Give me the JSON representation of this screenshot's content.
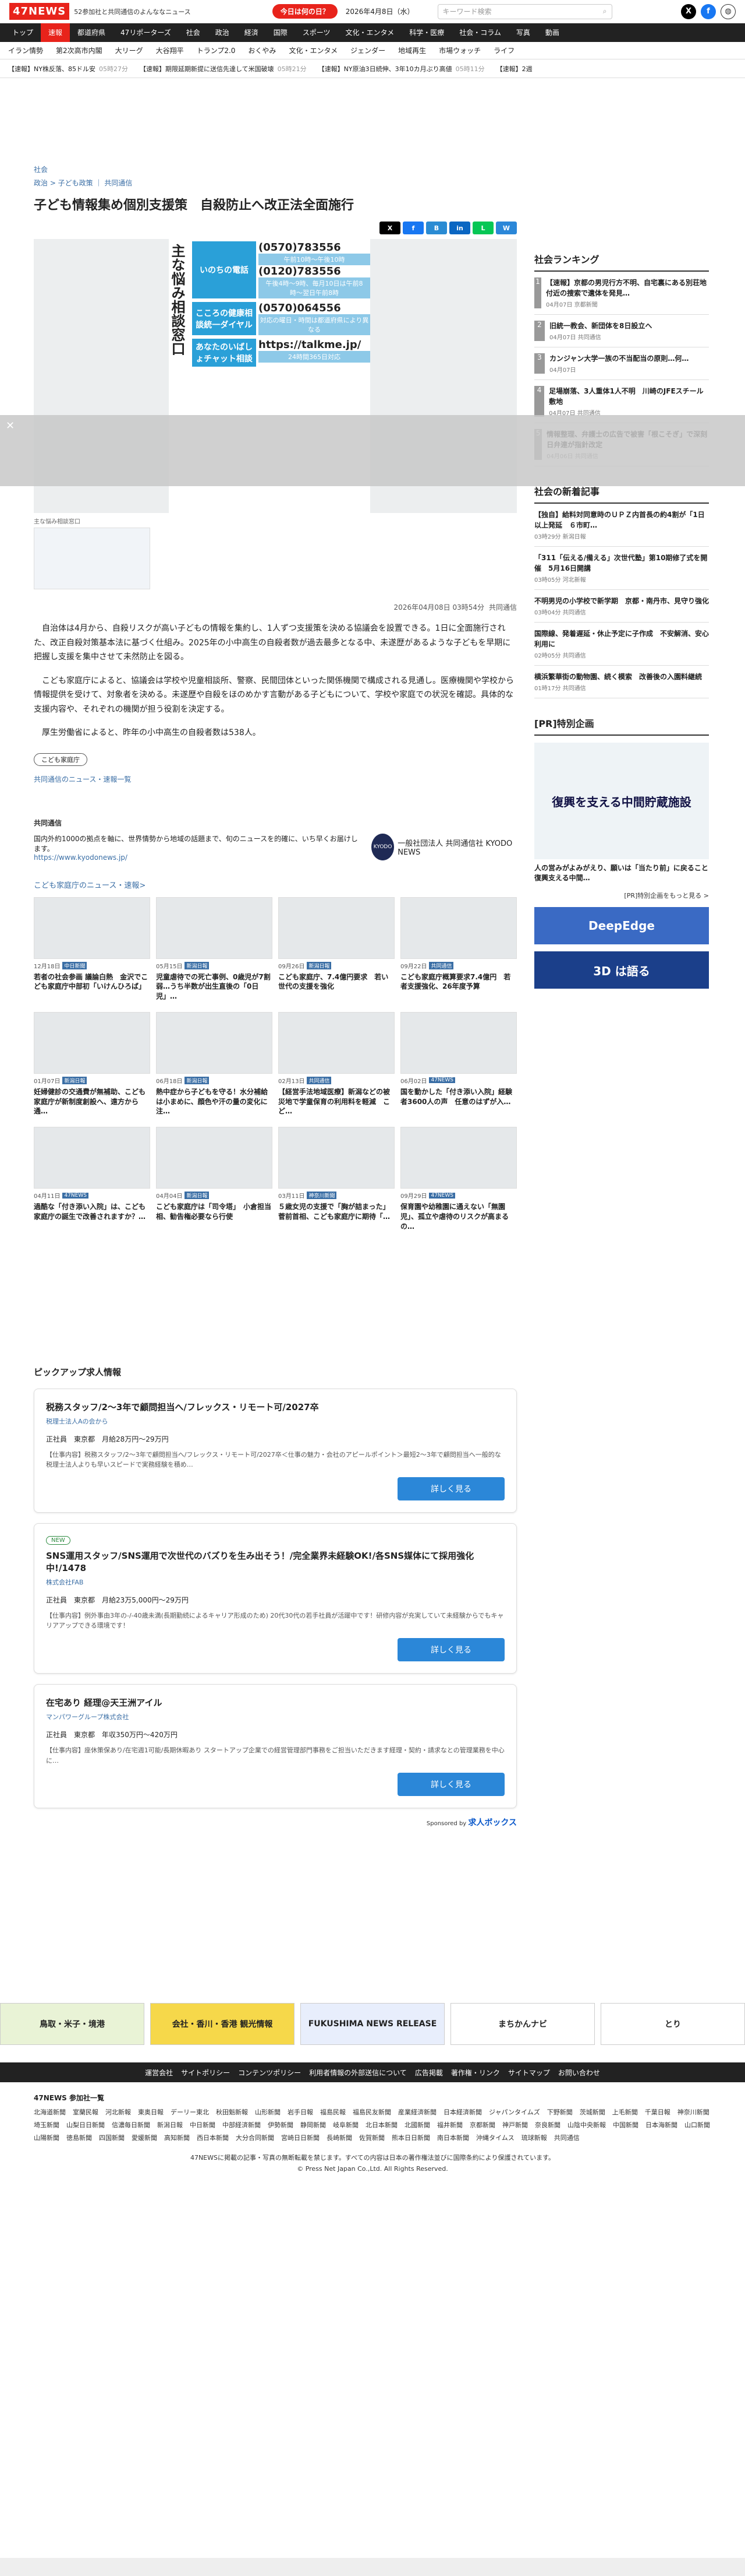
{
  "header": {
    "logo": "47NEWS",
    "tagline": "52参加社と共同通信のよんななニュース",
    "today_btn": "今日は何の日？",
    "date": "2026年4月8日（水）",
    "search_placeholder": "キーワード検索"
  },
  "nav1": [
    "トップ",
    "速報",
    "都道府県",
    "47リポーターズ",
    "社会",
    "政治",
    "経済",
    "国際",
    "スポーツ",
    "文化・エンタメ",
    "科学・医療",
    "社会・コラム",
    "写真",
    "動画"
  ],
  "nav2": [
    "イラン情勢",
    "第2次高市内閣",
    "大リーグ",
    "大谷翔平",
    "トランプ2.0",
    "おくやみ",
    "文化・エンタメ",
    "ジェンダー",
    "地域再生",
    "市場ウォッチ",
    "ライフ"
  ],
  "ticker": [
    {
      "t": "【速報】NY株反落、85ドル安",
      "tm": "05時27分"
    },
    {
      "t": "【速報】期限延期新提に送信先達して米国破壊",
      "tm": "05時21分"
    },
    {
      "t": "【速報】NY原油3日続伸、3年10カ月ぶり高値",
      "tm": "05時11分"
    },
    {
      "t": "【速報】2週",
      "tm": ""
    }
  ],
  "article": {
    "category": "社会",
    "breadcrumb": "政治 > 子ども政策 ｜ 共同通信",
    "title": "子ども情報集め個別支援策　自殺防止へ改正法全面施行",
    "share": [
      "X",
      "f",
      "B",
      "in",
      "L",
      "W"
    ],
    "photo": {
      "vtitle": "主な悩み相談窓口",
      "rows": [
        {
          "label": "いのちの電話",
          "nums": [
            "(0570)783556",
            "(0120)783556"
          ],
          "notes": [
            "午前10時〜午後10時",
            "午後4時〜9時、毎月10日は午前8時〜翌日午前8時"
          ]
        },
        {
          "label": "こころの健康相談統一ダイヤル",
          "nums": [
            "(0570)064556"
          ],
          "notes": [
            "対応の曜日・時間は都道府県により異なる"
          ]
        },
        {
          "label": "あなたのいばしょチャット相談",
          "nums": [
            "https://talkme.jp/"
          ],
          "notes": [
            "24時間365日対応"
          ]
        }
      ],
      "caption": "主な悩み相談窓口"
    },
    "meta_time": "2026年04月08日 03時54分",
    "meta_src": "共同通信",
    "body": [
      "自治体は4月から、自殺リスクが高い子どもの情報を集約し、1人ずつ支援策を決める協議会を設置できる。1日に全面施行された、改正自殺対策基本法に基づく仕組み。2025年の小中高生の自殺者数が過去最多となる中、未遂歴があるような子どもを早期に把握し支援を集中させて未然防止を図る。",
      "こども家庭庁によると、協議会は学校や児童相談所、警察、民間団体といった関係機関で構成される見通し。医療機関や学校から情報提供を受けて、対象者を決める。未遂歴や自殺をほのめかす言動がある子どもについて、学校や家庭での状況を確認。具体的な支援内容や、それぞれの機関が担う役割を決定する。",
      "厚生労働省によると、昨年の小中高生の自殺者数は538人。"
    ],
    "tag": "こども家庭庁",
    "tag_link": "共同通信のニュース・速報一覧"
  },
  "kyodo": {
    "head": "共同通信",
    "text": "国内外約1000の拠点を軸に、世界情勢から地域の話題まで、旬のニュースを的確に、いち早くお届けします。",
    "link": "https://www.kyodonews.jp/",
    "logo": "一般社団法人 共同通信社 KYODO NEWS"
  },
  "related": {
    "head": "こども家庭庁のニュース・速報>",
    "items": [
      {
        "date": "12月18日",
        "src": "中日新聞",
        "title": "若者の社会参画 議論白熱　金沢でこども家庭庁中部初「いけんひろば」"
      },
      {
        "date": "05月15日",
        "src": "新潟日報",
        "title": "児童虐待での死亡事例、0歳児が7割弱…うち半数が出生直後の「0日児」…"
      },
      {
        "date": "09月26日",
        "src": "新潟日報",
        "title": "こども家庭庁、7.4億円要求　若い世代の支援を強化"
      },
      {
        "date": "09月22日",
        "src": "共同通信",
        "title": "こども家庭庁概算要求7.4億円　若者支援強化、26年度予算"
      },
      {
        "date": "01月07日",
        "src": "新潟日報",
        "title": "妊婦健診の交通費が無補助、こども家庭庁が新制度創設へ、遠方から通…"
      },
      {
        "date": "06月18日",
        "src": "新潟日報",
        "title": "熱中症から子どもを守る！水分補給は小まめに、顔色や汗の量の変化に注…"
      },
      {
        "date": "02月13日",
        "src": "共同通信",
        "title": "【経営手法地域医療】新潟などの被災地で学童保育の利用料を軽減　こど…"
      },
      {
        "date": "06月02日",
        "src": "47NEWS",
        "title": "国を動かした「付き添い入院」経験者3600人の声　任意のはずが入…"
      },
      {
        "date": "04月11日",
        "src": "47NEWS",
        "title": "過酷な「付き添い入院」は、こども家庭庁の誕生で改善されますか？…"
      },
      {
        "date": "04月04日",
        "src": "新潟日報",
        "title": "こども家庭庁は「司令塔」　小倉担当相、勧告権必要なら行使"
      },
      {
        "date": "03月11日",
        "src": "神奈川新聞",
        "title": "５歳女児の支援で「胸が詰まった」　菅前首相、こども家庭庁に期待「…"
      },
      {
        "date": "09月29日",
        "src": "47NEWS",
        "title": "保育園や幼稚園に通えない「無園児」、孤立や虐待のリスクが高まるの…"
      }
    ]
  },
  "ranking": {
    "head": "社会ランキング",
    "items": [
      {
        "t": "【速報】京都の男児行方不明、自宅裏にある別荘地付近の捜索で遺体を発見…",
        "m": "04月07日 京都新聞"
      },
      {
        "t": "旧統一教会、新団体を8日設立へ",
        "m": "04月07日 共同通信"
      },
      {
        "t": "カンジャン大学一族の不当配当の原則…何…",
        "m": "04月07日"
      },
      {
        "t": "足場崩落、3人重体1人不明　川崎のJFEスチール敷地",
        "m": "04月07日 共同通信"
      },
      {
        "t": "情報整理、弁護士の広告で被害「根こそぎ」で深刻　日弁連が指針改定",
        "m": "04月06日 共同通信"
      }
    ]
  },
  "latest": {
    "head": "社会の新着記事",
    "items": [
      {
        "t": "【独自】給料対同意時のＵＰＺ内首長の約4割が「1日以上発延　６市町…",
        "m": "03時29分 新潟日報"
      },
      {
        "t": "「311「伝える/備える」次世代塾」第10期修了式を開催　5月16日開講",
        "m": "03時05分 河北新報"
      },
      {
        "t": "不明男児の小学校で新学期　京都・南丹市、見守り強化",
        "m": "03時04分 共同通信"
      },
      {
        "t": "国際線、発着遅延・休止予定に子作成　不安解消、安心利用に",
        "m": "02時05分 共同通信"
      },
      {
        "t": "横浜繁華街の動物園、続く模索　改善後の入園料継続",
        "m": "01時17分 共同通信"
      }
    ]
  },
  "promo": {
    "head": "[PR]特別企画",
    "title": "復興を支える中間貯蔵施設",
    "sub": "人の営みがよみがえり、願いは「当たり前」に戻ること　復興支える中間…",
    "link": "[PR]特別企画をもっと見る >",
    "banner1": "DeepEdge",
    "banner2": "3D は語る"
  },
  "pickup": {
    "head": "ピックアップ求人情報",
    "jobs": [
      {
        "title": "税務スタッフ/2〜3年で顧問担当へ/フレックス・リモート可/2027卒",
        "co": "税理士法人Aの会から",
        "type": "正社員",
        "loc": "東京都",
        "pay": "月給28万円〜29万円",
        "desc": "【仕事内容】税務スタッフ/2〜3年で顧問担当へ/フレックス・リモート可/2027卒＜仕事の魅力・会社のアピールポイント＞最短2〜3年で顧問担当へ一般的な税理士法人よりも早いスピードで実務経験を積め…",
        "btn": "詳しく見る"
      },
      {
        "title": "SNS運用スタッフ/SNS運用で次世代のバズりを生み出そう！/完全業界未経験OK!/各SNS媒体にて採用強化中!/1478",
        "co": "株式会社FAB",
        "type": "正社員",
        "loc": "東京都",
        "pay": "月給23万5,000円〜29万円",
        "desc": "【仕事内容】例外事由3年の-/-40歳未満(長期勤続によるキャリア形成のため) 20代30代の若手社員が活躍中です！研修内容が充実していて未経験からでもキャリアアップできる環境です！",
        "btn": "詳しく見る",
        "new": "NEW"
      },
      {
        "title": "在宅あり 経理@天王洲アイル",
        "co": "マンパワーグループ株式会社",
        "type": "正社員",
        "loc": "東京都",
        "pay": "年収350万円〜420万円",
        "desc": "【仕事内容】座休策保あり/在宅週1可能/長期休暇あり スタートアップ企業での経営管理部門事務をご担当いただきます経理・契約・請求なとの管理業務を中心に…",
        "btn": "詳しく見る"
      }
    ],
    "sponsor": "Sponsored by",
    "sponsor_name": "求人ボックス"
  },
  "banners": [
    "鳥取・米子・境港",
    "会社・香川・香港 観光情報",
    "FUKUSHIMA NEWS RELEASE",
    "まちかんナビ",
    "とり"
  ],
  "footer": {
    "links": [
      "運営会社",
      "サイトポリシー",
      "コンテンツポリシー",
      "利用者情報の外部送信について",
      "広告掲載",
      "著作権・リンク",
      "サイトマップ",
      "お問い合わせ"
    ],
    "head": "47NEWS 参加社一覧",
    "members": [
      "北海道新聞",
      "室蘭民報",
      "河北新報",
      "東奥日報",
      "デーリー東北",
      "秋田魁新報",
      "山形新聞",
      "岩手日報",
      "福島民報",
      "福島民友新聞",
      "産業経済新聞",
      "日本経済新聞",
      "ジャパンタイムズ",
      "下野新聞",
      "茨城新聞",
      "上毛新聞",
      "千葉日報",
      "神奈川新聞",
      "埼玉新聞",
      "山梨日日新聞",
      "信濃毎日新聞",
      "新潟日報",
      "中日新聞",
      "中部経済新聞",
      "伊勢新聞",
      "静岡新聞",
      "岐阜新聞",
      "北日本新聞",
      "北國新聞",
      "福井新聞",
      "京都新聞",
      "神戸新聞",
      "奈良新聞",
      "山陰中央新報",
      "中国新聞",
      "日本海新聞",
      "山口新聞",
      "山陽新聞",
      "徳島新聞",
      "四国新聞",
      "愛媛新聞",
      "高知新聞",
      "西日本新聞",
      "大分合同新聞",
      "宮崎日日新聞",
      "長崎新聞",
      "佐賀新聞",
      "熊本日日新聞",
      "南日本新聞",
      "沖縄タイムス",
      "琉球新報",
      "共同通信"
    ],
    "copy1": "47NEWSに掲載の記事・写真の無断転載を禁じます。すべての内容は日本の著作権法並びに国際条約により保護されています。",
    "copy2": "© Press Net Japan Co.,Ltd. All Rights Reserved."
  }
}
